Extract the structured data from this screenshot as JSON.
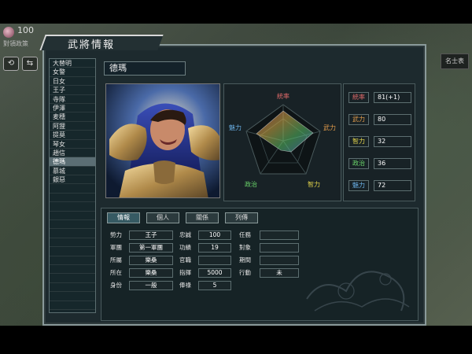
{
  "window": {
    "title": "武將情報"
  },
  "hud": {
    "counter": "100",
    "sub_text": "對領政策",
    "top_right_tag": "名士表"
  },
  "general": {
    "name": "德瑪",
    "portrait_icon": "warrior-portrait"
  },
  "general_list": [
    "大替明",
    "女警",
    "日女",
    "王子",
    "寺隊",
    "伊澤",
    "麦穗",
    "阿狸",
    "提莫",
    "琴女",
    "趙信",
    "德瑪",
    "慕城",
    "銀惡"
  ],
  "general_list_selected_index": 11,
  "radar": {
    "labels": {
      "top": "統率",
      "right": "武力",
      "bottom_right": "智力",
      "bottom_left": "政治",
      "left": "魅力"
    }
  },
  "stats": [
    {
      "label": "統率",
      "value": "81(+1)",
      "color": "#e06a6a"
    },
    {
      "label": "武力",
      "value": "80",
      "color": "#e09a4a"
    },
    {
      "label": "智力",
      "value": "32",
      "color": "#e0d24a"
    },
    {
      "label": "政治",
      "value": "36",
      "color": "#6ad46a"
    },
    {
      "label": "魅力",
      "value": "72",
      "color": "#6ab0e6"
    }
  ],
  "tabs": [
    {
      "label": "情報",
      "active": true
    },
    {
      "label": "個人",
      "active": false
    },
    {
      "label": "關係",
      "active": false
    },
    {
      "label": "列傳",
      "active": false
    }
  ],
  "info_left": [
    {
      "label": "勢力",
      "value": "王子"
    },
    {
      "label": "軍團",
      "value": "第一軍團"
    },
    {
      "label": "所屬",
      "value": "樂桑"
    },
    {
      "label": "所在",
      "value": "樂桑"
    },
    {
      "label": "身份",
      "value": "一般"
    }
  ],
  "info_mid": [
    {
      "label": "忠誠",
      "value": "100"
    },
    {
      "label": "功績",
      "value": "19"
    },
    {
      "label": "官職",
      "value": ""
    },
    {
      "label": "指揮",
      "value": "5000"
    },
    {
      "label": "俸祿",
      "value": "5"
    }
  ],
  "info_right": [
    {
      "label": "任務",
      "value": ""
    },
    {
      "label": "對象",
      "value": ""
    },
    {
      "label": "期間",
      "value": ""
    },
    {
      "label": "行動",
      "value": "未"
    }
  ]
}
